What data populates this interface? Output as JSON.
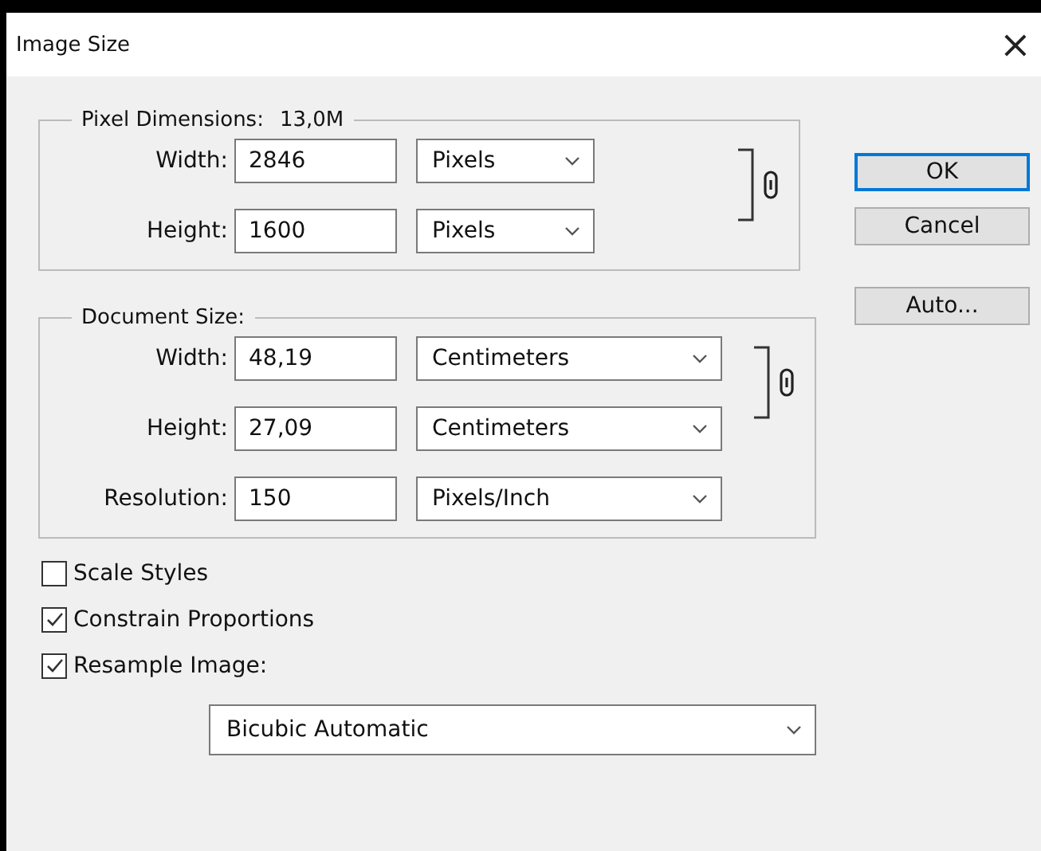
{
  "window": {
    "title": "Image Size",
    "close": "×"
  },
  "groups": [
    {
      "title": "Pixel Dimensions:",
      "value": "13,0M",
      "linked": true,
      "wide": false,
      "rows": [
        {
          "label": "Width:",
          "value": "2846",
          "unit": "Pixels"
        },
        {
          "label": "Height:",
          "value": "1600",
          "unit": "Pixels"
        }
      ]
    },
    {
      "title": "Document Size:",
      "linked": true,
      "wide": true,
      "rows": [
        {
          "label": "Width:",
          "value": "48,19",
          "unit": "Centimeters"
        },
        {
          "label": "Height:",
          "value": "27,09",
          "unit": "Centimeters"
        },
        {
          "label": "Resolution:",
          "value": "150",
          "unit": "Pixels/Inch"
        }
      ]
    }
  ],
  "options": [
    {
      "label": "Scale Styles",
      "checked": false
    },
    {
      "label": "Constrain Proportions",
      "checked": true
    },
    {
      "label": "Resample Image:",
      "checked": true
    }
  ],
  "resample_method": "Bicubic Automatic",
  "buttons": [
    {
      "label": "OK",
      "default": true
    },
    {
      "label": "Cancel",
      "default": false
    },
    {
      "label": "Auto...",
      "default": false
    }
  ]
}
